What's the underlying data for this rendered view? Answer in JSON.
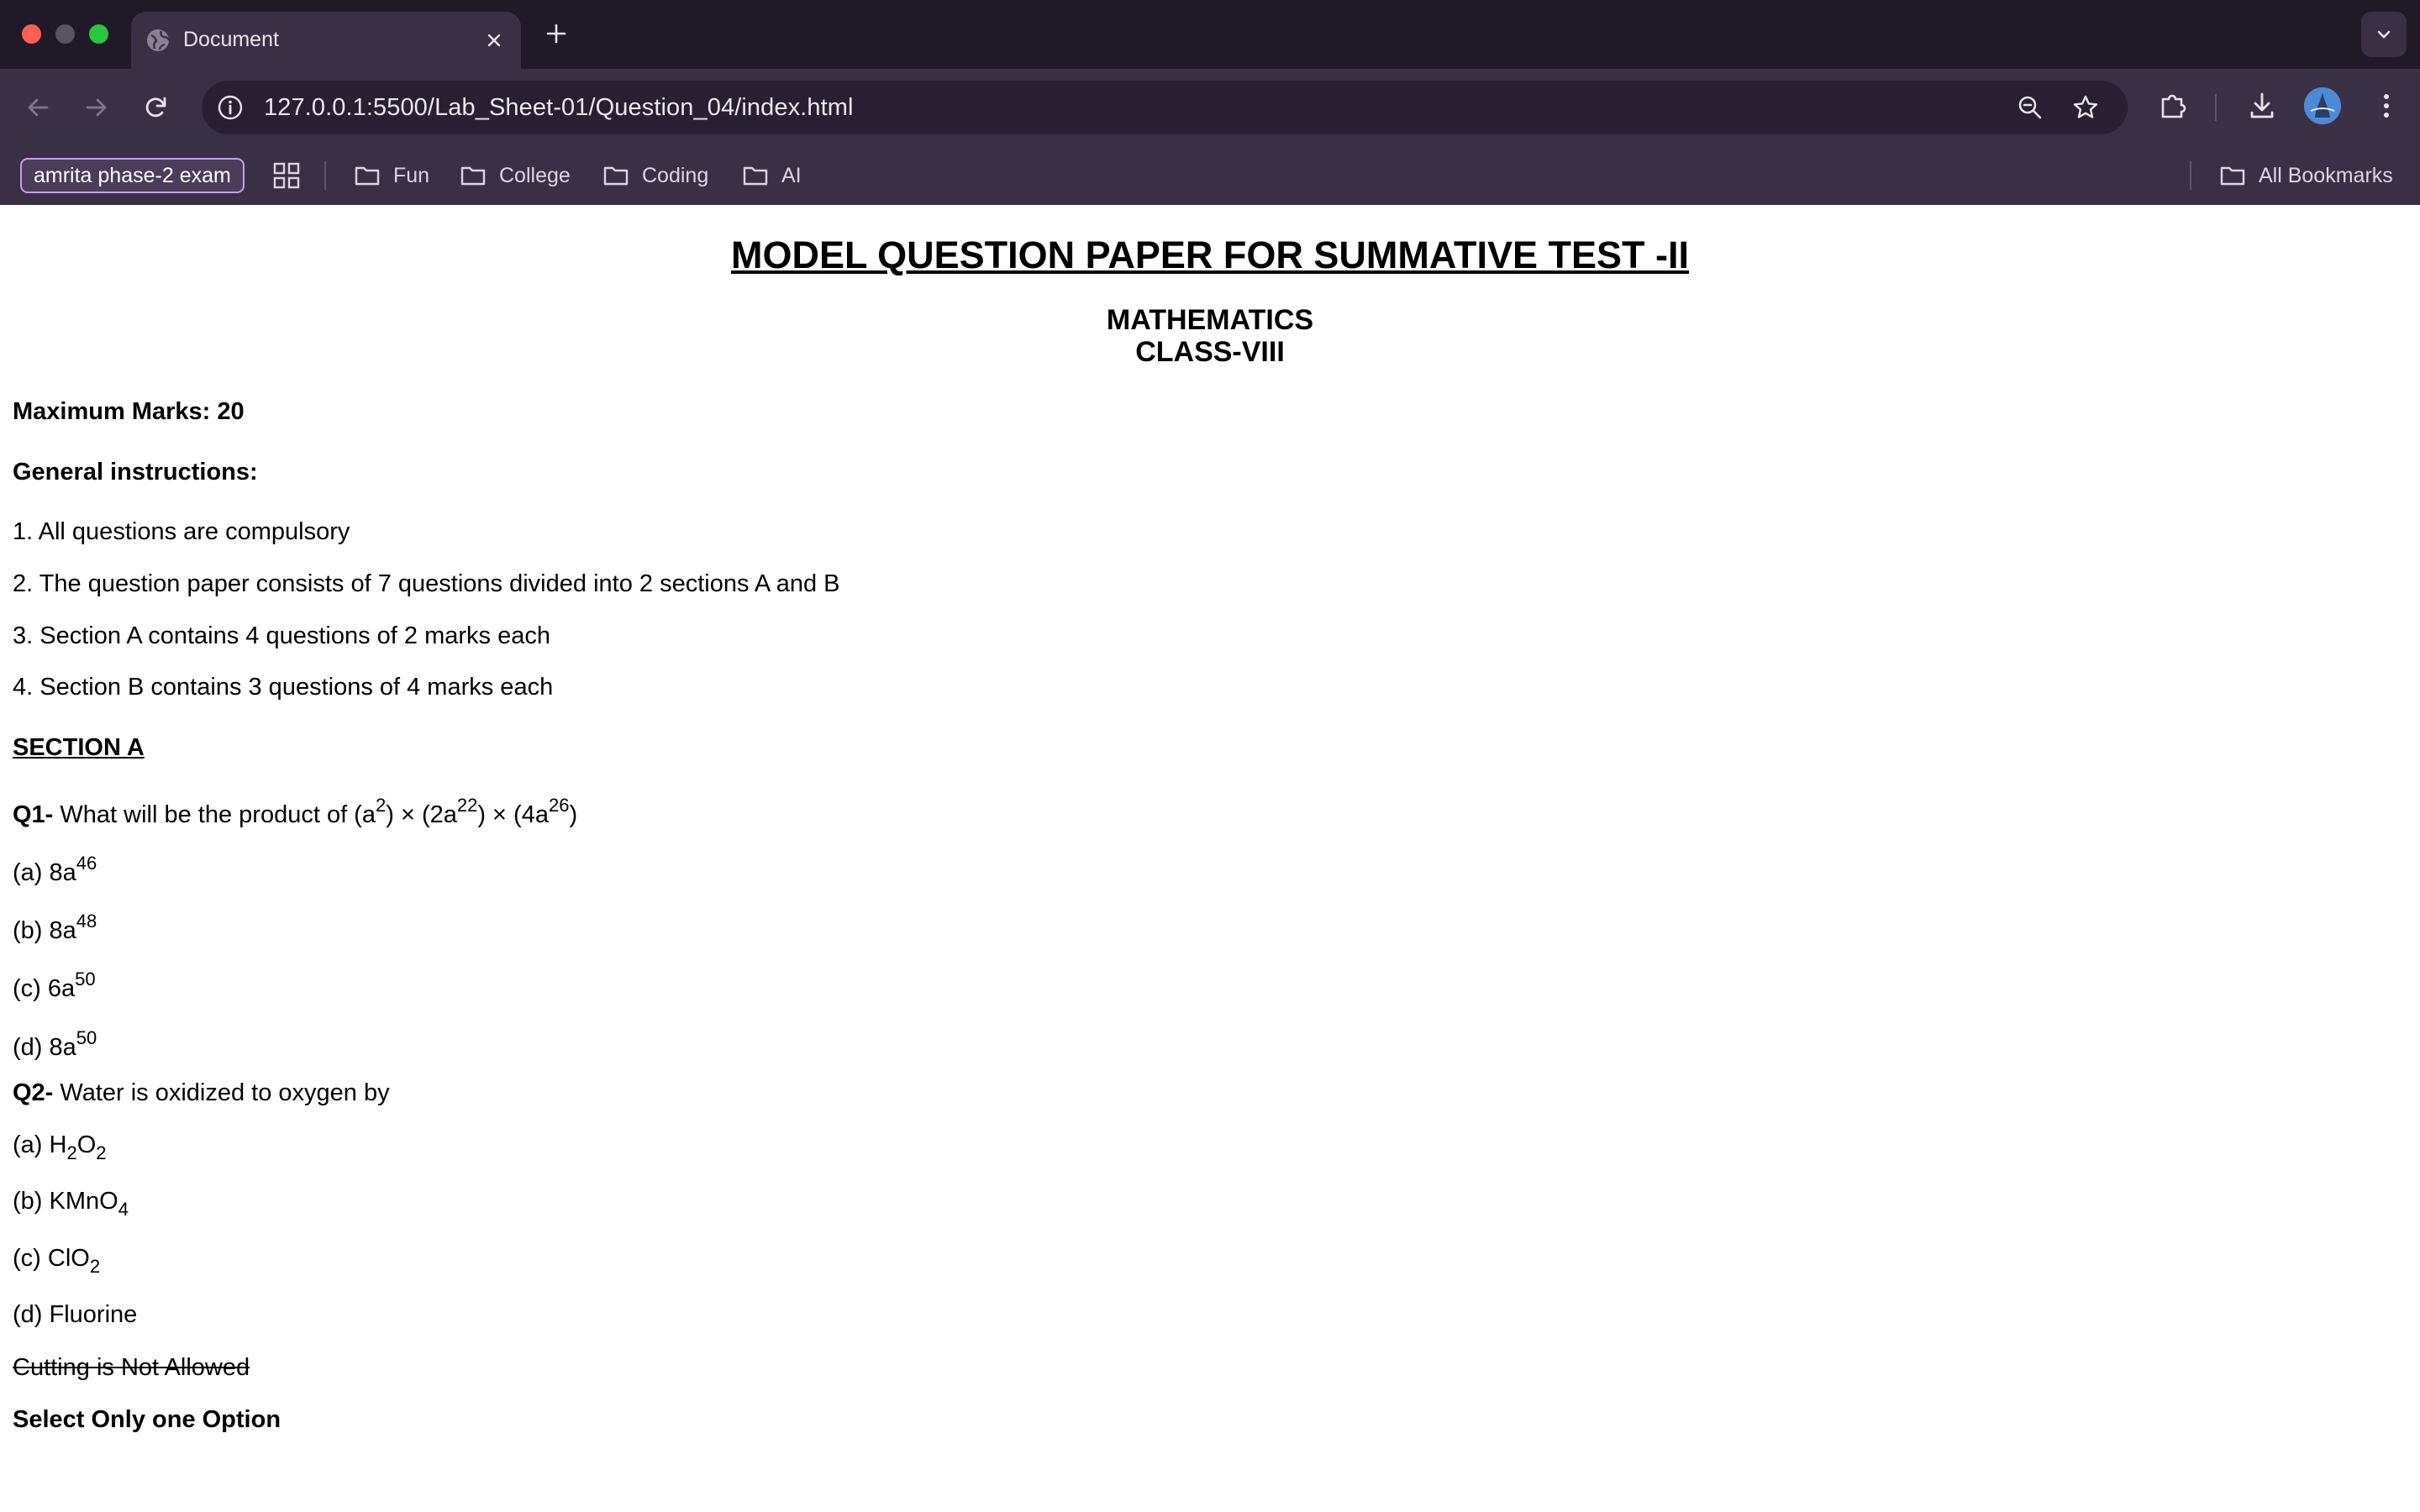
{
  "browser": {
    "tab": {
      "title": "Document"
    },
    "url": "127.0.0.1:5500/Lab_Sheet-01/Question_04/index.html",
    "bookmarks": {
      "chip": "amrita phase-2 exam",
      "folders": [
        "Fun",
        "College",
        "Coding",
        "AI"
      ],
      "all": "All Bookmarks"
    }
  },
  "paper": {
    "heading": "MODEL QUESTION PAPER FOR SUMMATIVE TEST -II",
    "subject": "MATHEMATICS",
    "class": "CLASS-VIII",
    "max_marks": "Maximum Marks: 20",
    "general_instructions": "General instructions:",
    "instructions": [
      "1. All questions are compulsory",
      "2. The question paper consists of 7 questions divided into 2 sections A and B",
      "3. Section A contains 4 questions of 2 marks each",
      "4. Section B contains 3 questions of 4 marks each"
    ],
    "section_a": "SECTION A",
    "q1": {
      "label": "Q1-",
      "text_1": " What will be the product of (a",
      "exp_1": "2",
      "text_2": ") × (2a",
      "exp_2": "22",
      "text_3": ") × (4a",
      "exp_3": "26",
      "text_4": ")",
      "options": [
        {
          "prefix": "(a) 8a",
          "exp": "46"
        },
        {
          "prefix": "(b) 8a",
          "exp": "48"
        },
        {
          "prefix": "(c) 6a",
          "exp": "50"
        },
        {
          "prefix": "(d) 8a",
          "exp": "50"
        }
      ]
    },
    "q2": {
      "label": "Q2-",
      "text": " Water is oxidized to oxygen by",
      "option_a": {
        "p1": "(a) H",
        "s1": "2",
        "p2": "O",
        "s2": "2"
      },
      "option_b": {
        "p1": "(b) KMnO",
        "s1": "4"
      },
      "option_c": {
        "p1": "(c) ClO",
        "s1": "2"
      },
      "option_d": "(d) Fluorine"
    },
    "cutting_note": "Cutting is Not Allowed",
    "select_note": "Select Only one Option"
  }
}
